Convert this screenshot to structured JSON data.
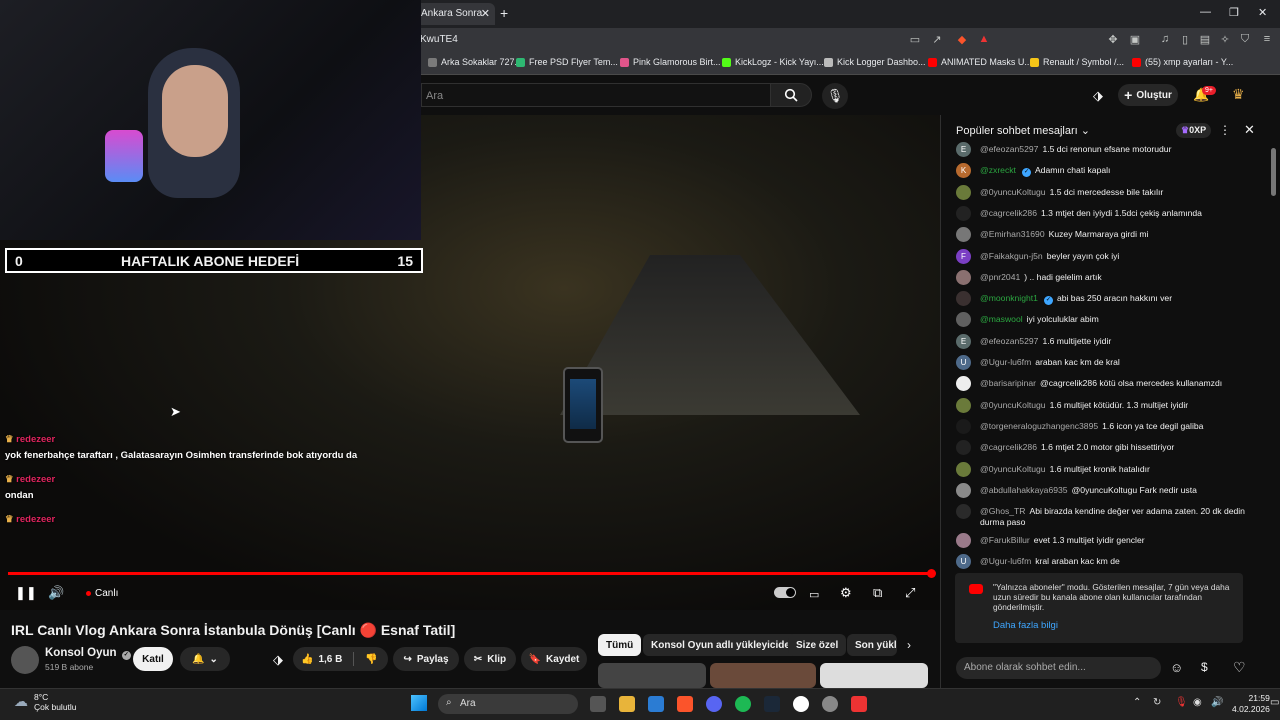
{
  "browser": {
    "tab_title": "Ankara Sonra",
    "url": "KwuTE4",
    "bookmarks": [
      {
        "label": "Arka Sokaklar 727....",
        "color": "#7a7a7a"
      },
      {
        "label": "Free PSD Flyer Tem...",
        "color": "#2eb872"
      },
      {
        "label": "Pink Glamorous Birt...",
        "color": "#e0558a"
      },
      {
        "label": "KickLogz - Kick Yayı...",
        "color": "#53fc18"
      },
      {
        "label": "Kick Logger Dashbo...",
        "color": "#bbbbbb"
      },
      {
        "label": "ANIMATED Masks U...",
        "color": "#ff0000"
      },
      {
        "label": "Renault / Symbol /...",
        "color": "#f5c518"
      },
      {
        "label": "(55) xmp ayarları - Y...",
        "color": "#ff0000"
      }
    ]
  },
  "header": {
    "search_placeholder": "Ara",
    "create_label": "Oluştur",
    "notif_count": "9+"
  },
  "overlay": {
    "goal_left": "0",
    "goal_title": "HAFTALIK ABONE HEDEFİ",
    "goal_right": "15",
    "chat": [
      {
        "name": "redezeer",
        "text": "yok fenerbahçe taraftarı , Galatasarayın Osimhen transferinde bok atıyordu da"
      },
      {
        "name": "redezeer",
        "text": "ondan"
      },
      {
        "name": "redezeer",
        "text": ""
      }
    ]
  },
  "player": {
    "live_label": "Canlı",
    "progress_percent": 100
  },
  "video": {
    "title": "IRL Canlı Vlog Ankara Sonra İstanbula Dönüş [Canlı 🔴 Esnaf Tatil]",
    "channel": "Konsol Oyun",
    "subscribers": "519 B abone",
    "join_label": "Katıl",
    "likes": "1,6 B",
    "share_label": "Paylaş",
    "clip_label": "Klip",
    "save_label": "Kaydet"
  },
  "chips": [
    "Tümü",
    "Konsol Oyun adlı yükleyiciden",
    "Size özel",
    "Son yükle"
  ],
  "chat": {
    "header": "Popüler sohbet mesajları",
    "xp": "0XP",
    "messages": [
      {
        "avatar": "E",
        "color": "#5a6b6b",
        "user": "@efeozan5297",
        "text": "1.5 dci renonun efsane motorudur",
        "member": false
      },
      {
        "avatar": "K",
        "color": "#b86a2e",
        "user": "@zxreckt",
        "text": "Adamın chati kapalı",
        "member": true,
        "verified": true
      },
      {
        "avatar": "",
        "color": "#6a7a3a",
        "user": "@0yuncuKoltugu",
        "text": "1.5 dci mercedesse bile takılır",
        "member": false
      },
      {
        "avatar": "",
        "color": "#222222",
        "user": "@cagrcelik286",
        "text": "1.3 mtjet den iyiydi 1.5dci çekiş anlamında",
        "member": false
      },
      {
        "avatar": "",
        "color": "#777777",
        "user": "@Emirhan31690",
        "text": "Kuzey Marmaraya girdi mi",
        "member": false
      },
      {
        "avatar": "F",
        "color": "#7b3fc4",
        "user": "@Faikakgun-j5n",
        "text": "beyler yayın çok iyi",
        "member": false
      },
      {
        "avatar": "",
        "color": "#8a7070",
        "user": "@pnr2041",
        "text": ") .. hadi gelelim artık",
        "member": false
      },
      {
        "avatar": "",
        "color": "#3a3030",
        "user": "@moonknight1",
        "text": "abi bas 250 aracın hakkını ver",
        "member": true,
        "verified": true
      },
      {
        "avatar": "",
        "color": "#606060",
        "user": "@maswool",
        "text": "iyi yolculuklar abim",
        "member": true
      },
      {
        "avatar": "E",
        "color": "#5a6b6b",
        "user": "@efeozan5297",
        "text": "1.6 multijette iyidir",
        "member": false
      },
      {
        "avatar": "U",
        "color": "#4e6a8a",
        "user": "@Ugur-lu6fm",
        "text": "araban kac km de kral",
        "member": false
      },
      {
        "avatar": "",
        "color": "#eeeeee",
        "user": "@barisaripinar",
        "text": "@cagrcelik286 kötü olsa mercedes kullanamzdı",
        "member": false
      },
      {
        "avatar": "",
        "color": "#6a7a3a",
        "user": "@0yuncuKoltugu",
        "text": "1.6 multijet kötüdür. 1.3 multijet iyidir",
        "member": false
      },
      {
        "avatar": "",
        "color": "#1a1a1a",
        "user": "@torgeneraloguzhangenc3895",
        "text": "1.6 icon ya tce degil galiba",
        "member": false
      },
      {
        "avatar": "",
        "color": "#222222",
        "user": "@cagrcelik286",
        "text": "1.6 mtjet 2.0 motor gibi hissettiriyor",
        "member": false
      },
      {
        "avatar": "",
        "color": "#6a7a3a",
        "user": "@0yuncuKoltugu",
        "text": "1.6 multijet kronik hatalıdır",
        "member": false
      },
      {
        "avatar": "",
        "color": "#8a8a8a",
        "user": "@abdullahakkaya6935",
        "text": "@0yuncuKoltugu Fark nedir usta",
        "member": false
      },
      {
        "avatar": "",
        "color": "#2a2a2a",
        "user": "@Ghos_TR",
        "text": "Abi birazda kendine değer ver adama zaten. 20 dk dedin durma paso",
        "member": false
      },
      {
        "avatar": "",
        "color": "#9a7a8a",
        "user": "@FarukBillur",
        "text": "evet 1.3 multijet iyidir gencler",
        "member": false
      },
      {
        "avatar": "U",
        "color": "#4e6a8a",
        "user": "@Ugur-lu6fm",
        "text": "kral araban kac km de",
        "member": false
      }
    ],
    "notice_text": "\"Yalnızca aboneler\" modu. Gösterilen mesajlar, 7 gün veya daha uzun süredir bu kanala abone olan kullanıcılar tarafından gönderilmiştir.",
    "notice_link": "Daha fazla bilgi",
    "input_placeholder": "Abone olarak sohbet edin..."
  },
  "taskbar": {
    "temp": "8°C",
    "weather": "Çok bulutlu",
    "search": "Ara",
    "time": "21:59",
    "date": "4.02.2026"
  }
}
